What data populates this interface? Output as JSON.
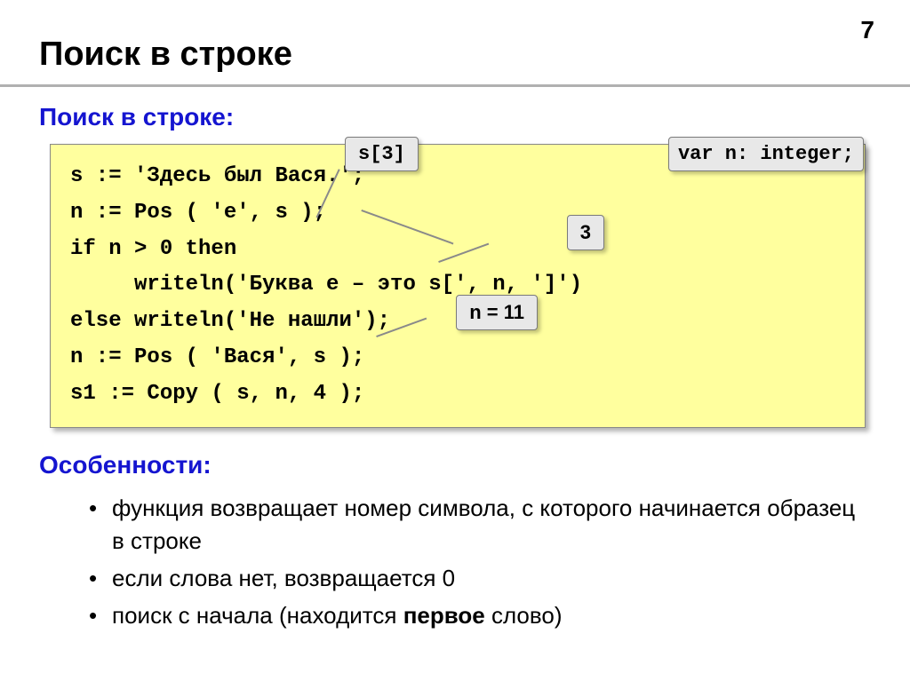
{
  "pageNumber": "7",
  "title": "Поиск в строке",
  "subheading": "Поиск в строке:",
  "callouts": {
    "s3": "s[3]",
    "varDecl": "var n: integer;",
    "three": "3",
    "n11": "n = 11"
  },
  "code": "s := 'Здесь был Вася.';\nn := Pos ( 'е', s );\nif n > 0 then\n     writeln('Буква е – это s[', n, ']')\nelse writeln('Не нашли');\nn := Pos ( 'Вася', s );\ns1 := Copy ( s, n, 4 );",
  "featuresHeading": "Особенности:",
  "features": {
    "item1": "функция возвращает номер символа, с которого начинается образец в строке",
    "item2": "если слова нет, возвращается 0",
    "item3_prefix": "поиск с начала (находится ",
    "item3_bold": "первое",
    "item3_suffix": " слово)"
  }
}
